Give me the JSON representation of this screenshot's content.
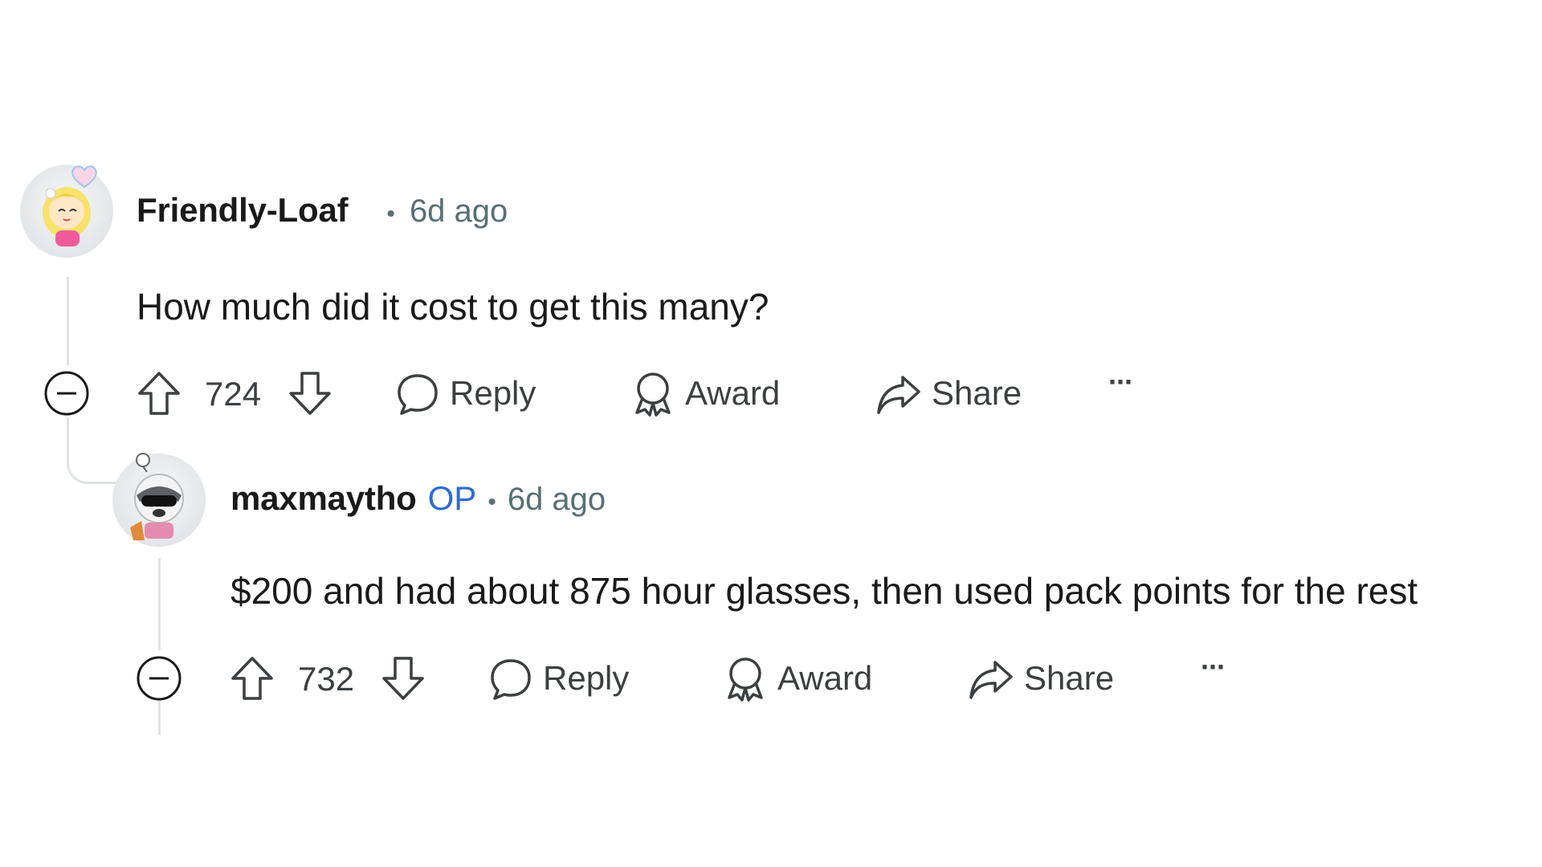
{
  "comments": [
    {
      "username": "Friendly-Loaf",
      "op_badge": "",
      "separator": "•",
      "time": "6d ago",
      "body": "How much did it cost to get this many?",
      "votes": "724",
      "actions": {
        "reply": "Reply",
        "award": "Award",
        "share": "Share",
        "more": "···"
      }
    },
    {
      "username": "maxmaytho",
      "op_badge": "OP",
      "separator": "•",
      "time": "6d ago",
      "body": "$200 and had about 875 hour glasses, then used pack points for the rest",
      "votes": "732",
      "actions": {
        "reply": "Reply",
        "award": "Award",
        "share": "Share",
        "more": "···"
      }
    }
  ],
  "colors": {
    "op": "#2c6bd6",
    "meta": "#576f76",
    "thread": "#dfe3e6"
  },
  "icons": [
    "collapse-icon",
    "upvote-icon",
    "downvote-icon",
    "reply-icon",
    "award-icon",
    "share-icon",
    "more-icon"
  ]
}
